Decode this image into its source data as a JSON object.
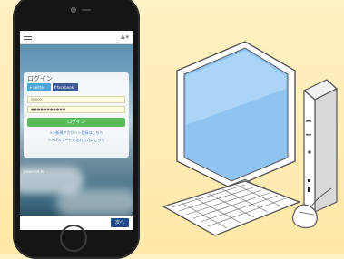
{
  "phone": {
    "app": {
      "title": "ログイン",
      "twitter_label": "twitter",
      "facebook_label": "facebook",
      "username_value": "seeco",
      "password_value": "●●●●●●●●●●●",
      "login_button": "ログイン",
      "new_account_link": ">>新規アカウント登録はこちら",
      "forgot_password_link": ">>パスワードを忘れた方はこちら",
      "powered_by": "powered by",
      "nav_button": "次へ"
    },
    "icons": {
      "menu": "hamburger-menu-icon",
      "user": "user-icon",
      "twitter": "twitter-icon",
      "facebook": "facebook-icon"
    }
  },
  "illustration": {
    "subject": "desktop-computer",
    "colors": {
      "background": "#ffeeb6",
      "monitor_body": "#ffffff",
      "monitor_screen": "#8fc3f0",
      "outline": "#555555"
    }
  }
}
